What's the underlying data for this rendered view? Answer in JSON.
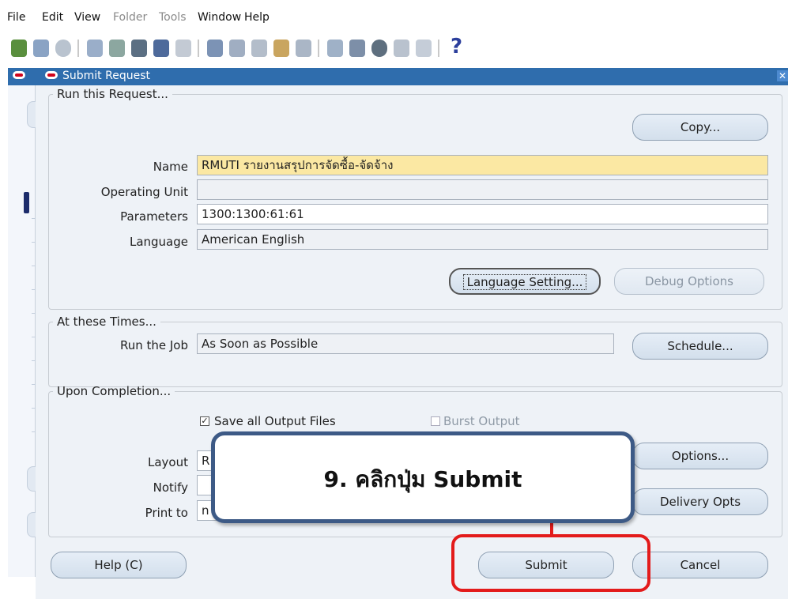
{
  "menu": [
    {
      "label": "File",
      "disabled": false
    },
    {
      "label": "Edit",
      "disabled": false
    },
    {
      "label": "View",
      "disabled": false
    },
    {
      "label": "Folder",
      "disabled": true
    },
    {
      "label": "Tools",
      "disabled": true
    },
    {
      "label": "Window",
      "disabled": false
    },
    {
      "label": "Help",
      "disabled": false
    }
  ],
  "toolbar": {
    "help_glyph": "?",
    "icons": [
      "new-record-icon",
      "find-icon",
      "navigator-icon",
      "save-icon",
      "next-step-icon",
      "print-icon",
      "print-preview-icon",
      "close-form-icon",
      "cut-icon",
      "copy-icon",
      "paste-icon",
      "clear-record-icon",
      "delete-record-icon",
      "edit-field-icon",
      "zoom-icon",
      "translations-icon",
      "attachments-icon",
      "folder-tools-icon",
      "help-icon"
    ]
  },
  "window": {
    "title": "Submit Request",
    "close_glyph": "✕"
  },
  "run_request": {
    "legend": "Run this Request...",
    "copy_button": "Copy...",
    "name_label": "Name",
    "name_value": "RMUTI รายงานสรุปการจัดซื้อ-จัดจ้าง",
    "operating_unit_label": "Operating Unit",
    "operating_unit_value": "",
    "parameters_label": "Parameters",
    "parameters_value": "1300:1300:61:61",
    "language_label": "Language",
    "language_value": "American English",
    "language_setting_button": "Language Setting...",
    "debug_options_button": "Debug Options"
  },
  "times": {
    "legend": "At these Times...",
    "run_job_label": "Run the Job",
    "run_job_value": "As Soon as Possible",
    "schedule_button": "Schedule..."
  },
  "completion": {
    "legend": "Upon Completion...",
    "save_output_label": "Save all Output Files",
    "save_output_checked": true,
    "burst_output_label": "Burst Output",
    "burst_output_checked": false,
    "layout_label": "Layout",
    "layout_value": "R",
    "notify_label": "Notify",
    "notify_value": "",
    "print_to_label": "Print to",
    "print_to_value": "n",
    "options_button": "Options...",
    "delivery_button": "Delivery Opts"
  },
  "footer": {
    "help_button": "Help (C)",
    "submit_button": "Submit",
    "cancel_button": "Cancel"
  },
  "annotation": {
    "text": "9. คลิกปุ่ม Submit",
    "highlight_color": "#e31b1b",
    "border_color": "#3d5a86"
  }
}
